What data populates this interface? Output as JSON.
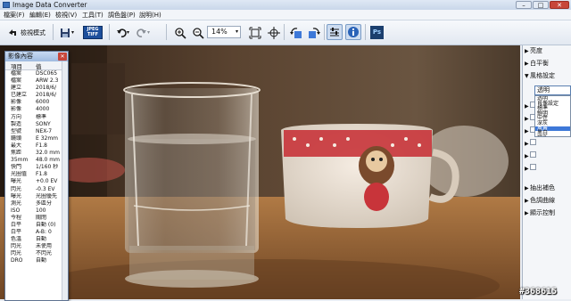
{
  "window": {
    "title": "Image Data Converter",
    "minimize": "–",
    "maximize": "□",
    "close": "✕"
  },
  "menu": [
    "檔案(F)",
    "編輯(E)",
    "檢視(V)",
    "工具(T)",
    "調色盤(P)",
    "說明(H)"
  ],
  "toolbar": {
    "view_mode_label": "檢視模式",
    "jpeg_tiff_top": "JPEG",
    "jpeg_tiff_bottom": "TIFF",
    "zoom_value": "14%",
    "ps_label": "Ps"
  },
  "right_panel": {
    "sections_top": [
      "亮度",
      "白平衡",
      "風格設定"
    ],
    "wb_selected": "透明",
    "wb_options": [
      "透明",
      "肖像設定",
      "標準",
      "鮮明",
      "中性",
      "深灰",
      "風景",
      "黑白",
      "褐色"
    ],
    "wb_highlight_index": 6,
    "sections_bottom": [
      "抽出補色",
      "色調曲線",
      "顯示控制"
    ]
  },
  "info_panel": {
    "title": "影像內容",
    "headers": [
      "項目",
      "值"
    ],
    "rows": [
      [
        "檔案",
        "DSC065"
      ],
      [
        "檔案",
        "ARW 2.3"
      ],
      [
        "建立",
        "2018/6/"
      ],
      [
        "已建立",
        "2018/6/"
      ],
      [
        "影像",
        "6000"
      ],
      [
        "影像",
        "4000"
      ],
      [
        "方向",
        "標準"
      ],
      [
        "製造",
        "SONY"
      ],
      [
        "型號",
        "NEX-7"
      ],
      [
        "鏡頭",
        "E 32mm"
      ],
      [
        "最大",
        "F1.8"
      ],
      [
        "焦距",
        "32.0 mm"
      ],
      [
        "35mm",
        "48.0 mm"
      ],
      [
        "快門",
        "1/160 秒"
      ],
      [
        "光圈值",
        "F1.8"
      ],
      [
        "曝光",
        "+0.0 EV"
      ],
      [
        "閃光",
        "-0.3 EV"
      ],
      [
        "曝光",
        "光圈優先"
      ],
      [
        "測光",
        "多區分"
      ],
      [
        "ISO",
        "100"
      ],
      [
        "今程",
        "關閉"
      ],
      [
        "白平",
        "自動 (0)"
      ],
      [
        "白平",
        "A-B: 0"
      ],
      [
        "色溫",
        "自動"
      ],
      [
        "閃光",
        "未使用"
      ],
      [
        "閃光",
        "不閃光"
      ],
      [
        "DRO",
        "自動"
      ]
    ]
  },
  "watermark": "#368615",
  "colors": {
    "accent": "#3d78d8",
    "ps_blue": "#1b3f6e"
  }
}
